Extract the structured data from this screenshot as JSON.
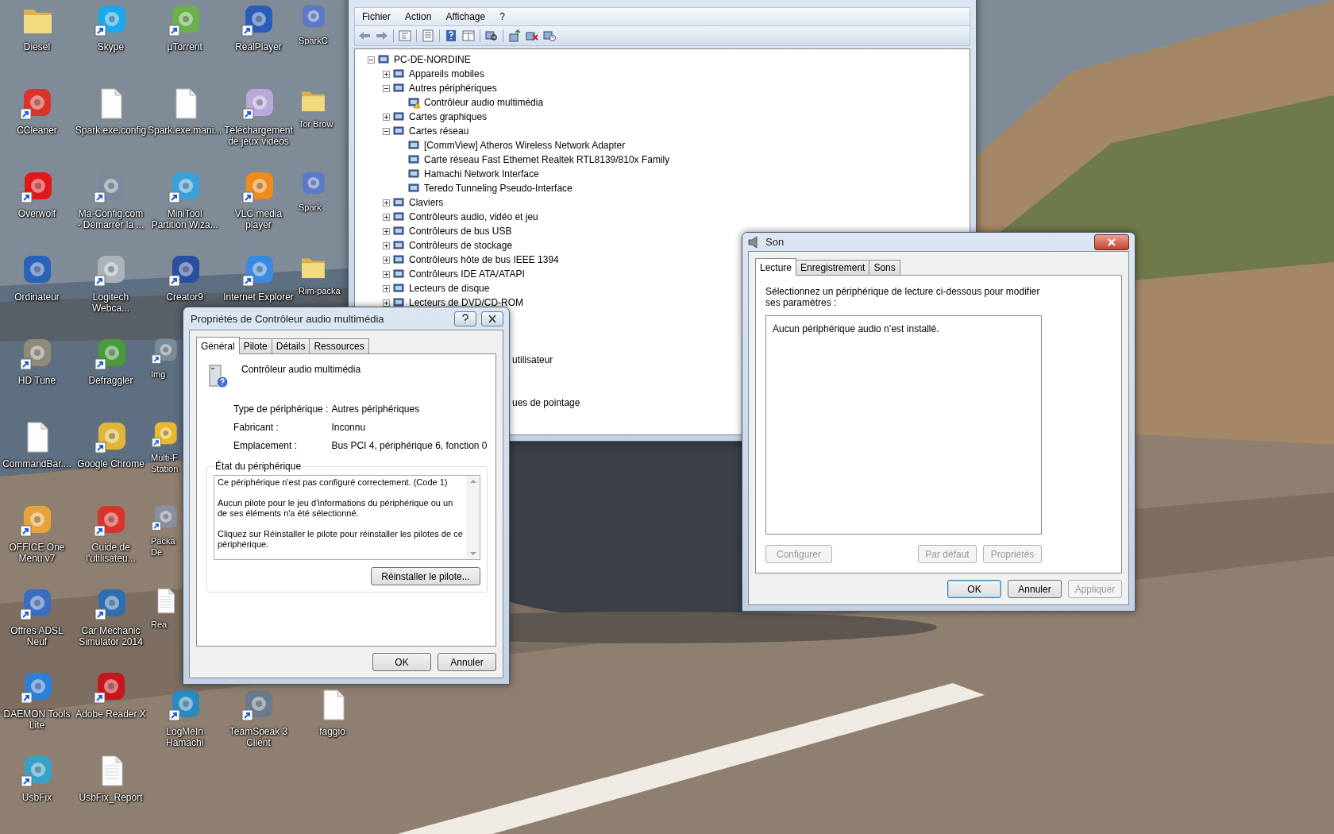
{
  "desktop": {
    "columns": [
      {
        "icons": [
          {
            "label": "Diesel",
            "kind": "folder",
            "shortcut": false,
            "cut": false
          },
          {
            "label": "CCleaner",
            "kind": "app",
            "color": "#d9342b",
            "shortcut": true,
            "cut": false
          },
          {
            "label": "Overwolf",
            "kind": "app",
            "color": "#e0181b",
            "shortcut": true,
            "cut": false
          },
          {
            "label": "Ordinateur",
            "kind": "app",
            "color": "#2a62b8",
            "shortcut": false,
            "cut": false
          },
          {
            "label": "HD Tune",
            "kind": "app",
            "color": "#8d8a7a",
            "shortcut": true,
            "cut": false
          },
          {
            "label": "CommandBar....",
            "kind": "file",
            "shortcut": false,
            "cut": false
          },
          {
            "label": "OFFICE One\nMenu v7",
            "kind": "app",
            "color": "#e8a23a",
            "shortcut": true,
            "cut": false
          },
          {
            "label": "Offres ADSL\nNeuf",
            "kind": "app",
            "color": "#3b6cc4",
            "shortcut": true,
            "cut": false
          },
          {
            "label": "DAEMON Tools\nLite",
            "kind": "app",
            "color": "#2f7fd6",
            "shortcut": true,
            "cut": false
          },
          {
            "label": "UsbFix",
            "kind": "app",
            "color": "#3aa0c8",
            "shortcut": true,
            "cut": false
          }
        ]
      },
      {
        "icons": [
          {
            "label": "Skype",
            "kind": "app",
            "color": "#1ba9e9",
            "shortcut": true,
            "cut": false
          },
          {
            "label": "Spark.exe.config",
            "kind": "file",
            "shortcut": false,
            "cut": false
          },
          {
            "label": "Ma-Config.com\n- Démarrer la ...",
            "kind": "app",
            "color": "#7a8a9a",
            "shortcut": true,
            "cut": false
          },
          {
            "label": "Logitech\nWebca...",
            "kind": "app",
            "color": "#aab3bb",
            "shortcut": true,
            "cut": false
          },
          {
            "label": "Defraggler",
            "kind": "app",
            "color": "#4a9a3a",
            "shortcut": true,
            "cut": false
          },
          {
            "label": "Google Chrome",
            "kind": "app",
            "color": "#e0b63a",
            "shortcut": true,
            "cut": false
          },
          {
            "label": "Guide de\nl'utilisateu...",
            "kind": "app",
            "color": "#d9342b",
            "shortcut": true,
            "cut": false
          },
          {
            "label": "Car Mechanic\nSimulator 2014",
            "kind": "app",
            "color": "#2f6fb0",
            "shortcut": true,
            "cut": false
          },
          {
            "label": "Adobe Reader X",
            "kind": "app",
            "color": "#c8161d",
            "shortcut": true,
            "cut": false
          },
          {
            "label": "UsbFix_Report",
            "kind": "text",
            "shortcut": false,
            "cut": false
          }
        ]
      },
      {
        "icons": [
          {
            "label": "µTorrent",
            "kind": "app",
            "color": "#6ab04c",
            "shortcut": true,
            "cut": false
          },
          {
            "label": "Spark.exe.mani...",
            "kind": "file",
            "shortcut": false,
            "cut": false
          },
          {
            "label": "MiniTool\nPartition Wiza...",
            "kind": "app",
            "color": "#3aa0d8",
            "shortcut": true,
            "cut": false
          },
          {
            "label": "Creator9",
            "kind": "app",
            "color": "#2a4fa0",
            "shortcut": true,
            "cut": false
          },
          {
            "label": "Img",
            "kind": "app",
            "color": "#7a8a99",
            "shortcut": true,
            "cut": true
          },
          {
            "label": "Multi-F\nStation",
            "kind": "app",
            "color": "#e8b830",
            "shortcut": true,
            "cut": true
          },
          {
            "label": "Packa\nDe",
            "kind": "app",
            "color": "#8a8fa0",
            "shortcut": true,
            "cut": true
          },
          {
            "label": "Rea",
            "kind": "text",
            "shortcut": false,
            "cut": true
          }
        ],
        "lower_icons": [
          {
            "label": "LogMeIn\nHamachi",
            "kind": "app",
            "color": "#2a8ac0",
            "shortcut": true,
            "cut": false
          }
        ]
      },
      {
        "icons": [
          {
            "label": "RealPlayer",
            "kind": "app",
            "color": "#2a5cb8",
            "shortcut": true,
            "cut": false
          },
          {
            "label": "Téléchargement\nde jeux vidéos",
            "kind": "app",
            "color": "#b9a8d8",
            "shortcut": true,
            "cut": false
          },
          {
            "label": "VLC media\nplayer",
            "kind": "app",
            "color": "#f08a1c",
            "shortcut": true,
            "cut": false
          },
          {
            "label": "Internet Explorer",
            "kind": "app",
            "color": "#3a8ae0",
            "shortcut": true,
            "cut": false
          }
        ],
        "lower_icons": [
          {
            "label": "TeamSpeak 3\nClient",
            "kind": "app",
            "color": "#6a7a8a",
            "shortcut": true,
            "cut": false
          }
        ]
      },
      {
        "icons": [
          {
            "label": "SparkC",
            "kind": "app",
            "color": "#5a7ac8",
            "shortcut": false,
            "cut": true
          },
          {
            "label": "Tor Brow",
            "kind": "folder",
            "shortcut": false,
            "cut": true
          },
          {
            "label": "Spark",
            "kind": "app",
            "color": "#5a7ac8",
            "shortcut": false,
            "cut": true
          },
          {
            "label": "Rim-packa",
            "kind": "folder",
            "shortcut": false,
            "cut": true
          }
        ],
        "lower_icons": [
          {
            "label": "faggio",
            "kind": "file",
            "shortcut": false,
            "cut": false
          }
        ]
      }
    ]
  },
  "device_manager": {
    "menu": [
      "Fichier",
      "Action",
      "Affichage",
      "?"
    ],
    "tree": {
      "label": "PC-DE-NORDINE",
      "expanded": true,
      "children": [
        {
          "label": "Appareils mobiles",
          "kind": "category",
          "expanded": false
        },
        {
          "label": "Autres périphériques",
          "kind": "category",
          "expanded": true,
          "children": [
            {
              "label": "Contrôleur audio multimédia",
              "warning": true
            }
          ]
        },
        {
          "label": "Cartes graphiques",
          "kind": "category",
          "expanded": false
        },
        {
          "label": "Cartes réseau",
          "kind": "category",
          "expanded": true,
          "children": [
            {
              "label": "[CommView] Atheros Wireless Network Adapter",
              "warning": false
            },
            {
              "label": "Carte réseau Fast Ethernet Realtek RTL8139/810x Family",
              "warning": false
            },
            {
              "label": "Hamachi Network Interface",
              "warning": false
            },
            {
              "label": "Teredo Tunneling Pseudo-Interface",
              "warning": false
            }
          ]
        },
        {
          "label": "Claviers",
          "kind": "category",
          "expanded": false
        },
        {
          "label": "Contrôleurs audio, vidéo et jeu",
          "kind": "category",
          "expanded": false
        },
        {
          "label": "Contrôleurs de bus USB",
          "kind": "category",
          "expanded": false
        },
        {
          "label": "Contrôleurs de stockage",
          "kind": "category",
          "expanded": false
        },
        {
          "label": "Contrôleurs hôte de bus IEEE 1394",
          "kind": "category",
          "expanded": false
        },
        {
          "label": "Contrôleurs IDE ATA/ATAPI",
          "kind": "category",
          "expanded": false
        },
        {
          "label": "Lecteurs de disque",
          "kind": "category",
          "expanded": false
        },
        {
          "label": "Lecteurs de DVD/CD-ROM",
          "kind": "category",
          "expanded": false
        },
        {
          "label": "utilisateur",
          "kind": "cut"
        },
        {
          "label": "ues de pointage",
          "kind": "cut"
        }
      ]
    }
  },
  "properties": {
    "title": "Propriétés de Contrôleur audio multimédia",
    "tabs": [
      {
        "label": "Général",
        "selected": true
      },
      {
        "label": "Pilote",
        "selected": false
      },
      {
        "label": "Détails",
        "selected": false
      },
      {
        "label": "Ressources",
        "selected": false
      }
    ],
    "device_name": "Contrôleur audio multimédia",
    "fields": [
      {
        "label": "Type de périphérique :",
        "value": "Autres périphériques"
      },
      {
        "label": "Fabricant :",
        "value": "Inconnu"
      },
      {
        "label": "Emplacement :",
        "value": "Bus PCI 4, périphérique 6, fonction 0"
      }
    ],
    "status_group": "État du périphérique",
    "status_text": [
      "Ce périphérique n'est pas configuré correctement. (Code 1)",
      "Aucun pilote pour le jeu d'informations du périphérique ou un de ses éléments n'a été sélectionné.",
      "Cliquez sur Réinstaller le pilote pour réinstaller les pilotes de ce périphérique."
    ],
    "reinstall_button": "Réinstaller le pilote...",
    "buttons": [
      "OK",
      "Annuler"
    ]
  },
  "son": {
    "title": "Son",
    "tabs": [
      {
        "label": "Lecture",
        "selected": true
      },
      {
        "label": "Enregistrement",
        "selected": false
      },
      {
        "label": "Sons",
        "selected": false
      }
    ],
    "instruction": "Sélectionnez un périphérique de lecture ci-dessous pour modifier ses paramètres :",
    "empty_message": "Aucun périphérique audio n’est installé.",
    "device_buttons": [
      {
        "label": "Configurer",
        "disabled": true
      },
      {
        "label": "Par défaut",
        "disabled": true
      },
      {
        "label": "Propriétés",
        "disabled": true
      }
    ],
    "buttons": [
      {
        "label": "OK",
        "disabled": false,
        "default": true
      },
      {
        "label": "Annuler",
        "disabled": false,
        "default": false
      },
      {
        "label": "Appliquer",
        "disabled": true,
        "default": false
      }
    ]
  }
}
